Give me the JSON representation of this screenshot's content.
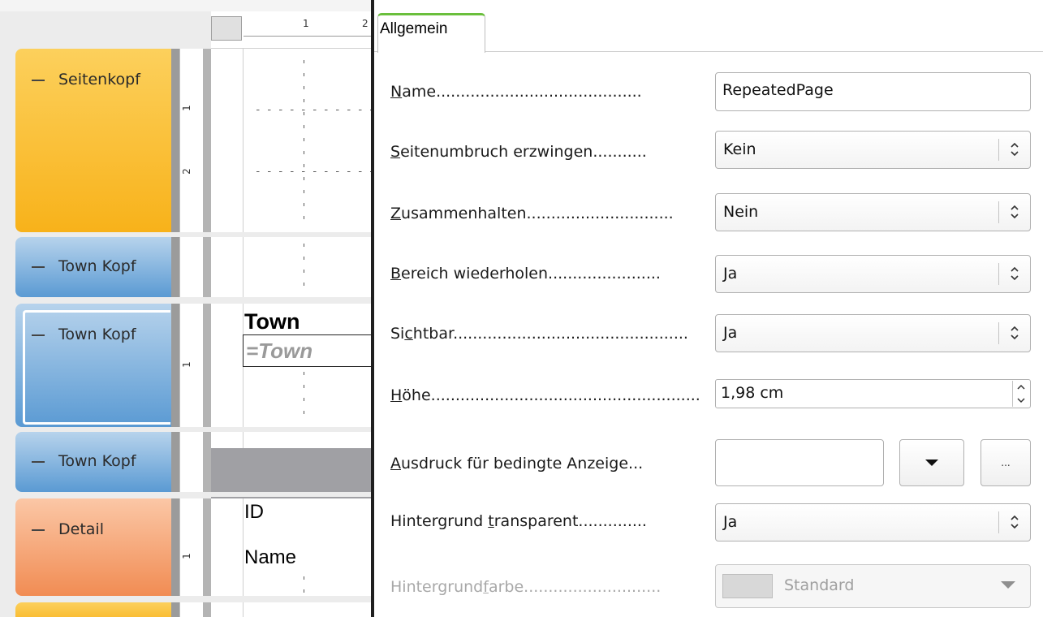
{
  "designer": {
    "ruler_numbers": [
      "1",
      "2"
    ],
    "sections": [
      {
        "label": "Seitenkopf",
        "ruler": [
          "1",
          "2"
        ]
      },
      {
        "label": "Town Kopf",
        "ruler": []
      },
      {
        "label": "Town Kopf",
        "ruler": [
          "1"
        ]
      },
      {
        "label": "Town Kopf",
        "ruler": []
      },
      {
        "label": "Detail",
        "ruler": [
          "1"
        ]
      }
    ],
    "fields": {
      "town_label": "Town",
      "town_expr": "=Town",
      "detail_id": "ID",
      "detail_name": "Name"
    }
  },
  "panel": {
    "tab": "Allgemein",
    "properties": {
      "name": {
        "u": "N",
        "rest": "ame",
        "dots": "..........................................",
        "value": "RepeatedPage"
      },
      "pagebreak": {
        "u": "S",
        "rest": "eitenumbruch erzwingen",
        "dots": "...........",
        "value": "Kein"
      },
      "keep": {
        "u": "Z",
        "rest": "usammenhalten",
        "dots": "..............................",
        "value": "Nein"
      },
      "repeat": {
        "u": "B",
        "rest": "ereich wiederholen",
        "dots": ".......................",
        "value": "Ja"
      },
      "visible": {
        "pre": "Si",
        "u": "c",
        "rest": "htbar",
        "dots": "................................................",
        "value": "Ja"
      },
      "height": {
        "u": "H",
        "rest": "öhe",
        "dots": ".......................................................",
        "value": "1,98 cm"
      },
      "condition": {
        "u": "A",
        "rest": "usdruck für bedingte Anzeige...",
        "value": "",
        "more_label": "..."
      },
      "transparent": {
        "pre": "Hintergrund ",
        "u": "t",
        "rest": "ransparent",
        "dots": "..............",
        "value": "Ja"
      },
      "bgcolor": {
        "pre": "Hintergrund",
        "u": "f",
        "rest": "arbe",
        "dots": "............................",
        "value": "Standard"
      }
    }
  },
  "colors": {
    "tab_accent": "#6abf3c",
    "section_page_header": "#f8b21a",
    "section_group_header": "#5a9ad3",
    "section_detail": "#f18c53"
  }
}
